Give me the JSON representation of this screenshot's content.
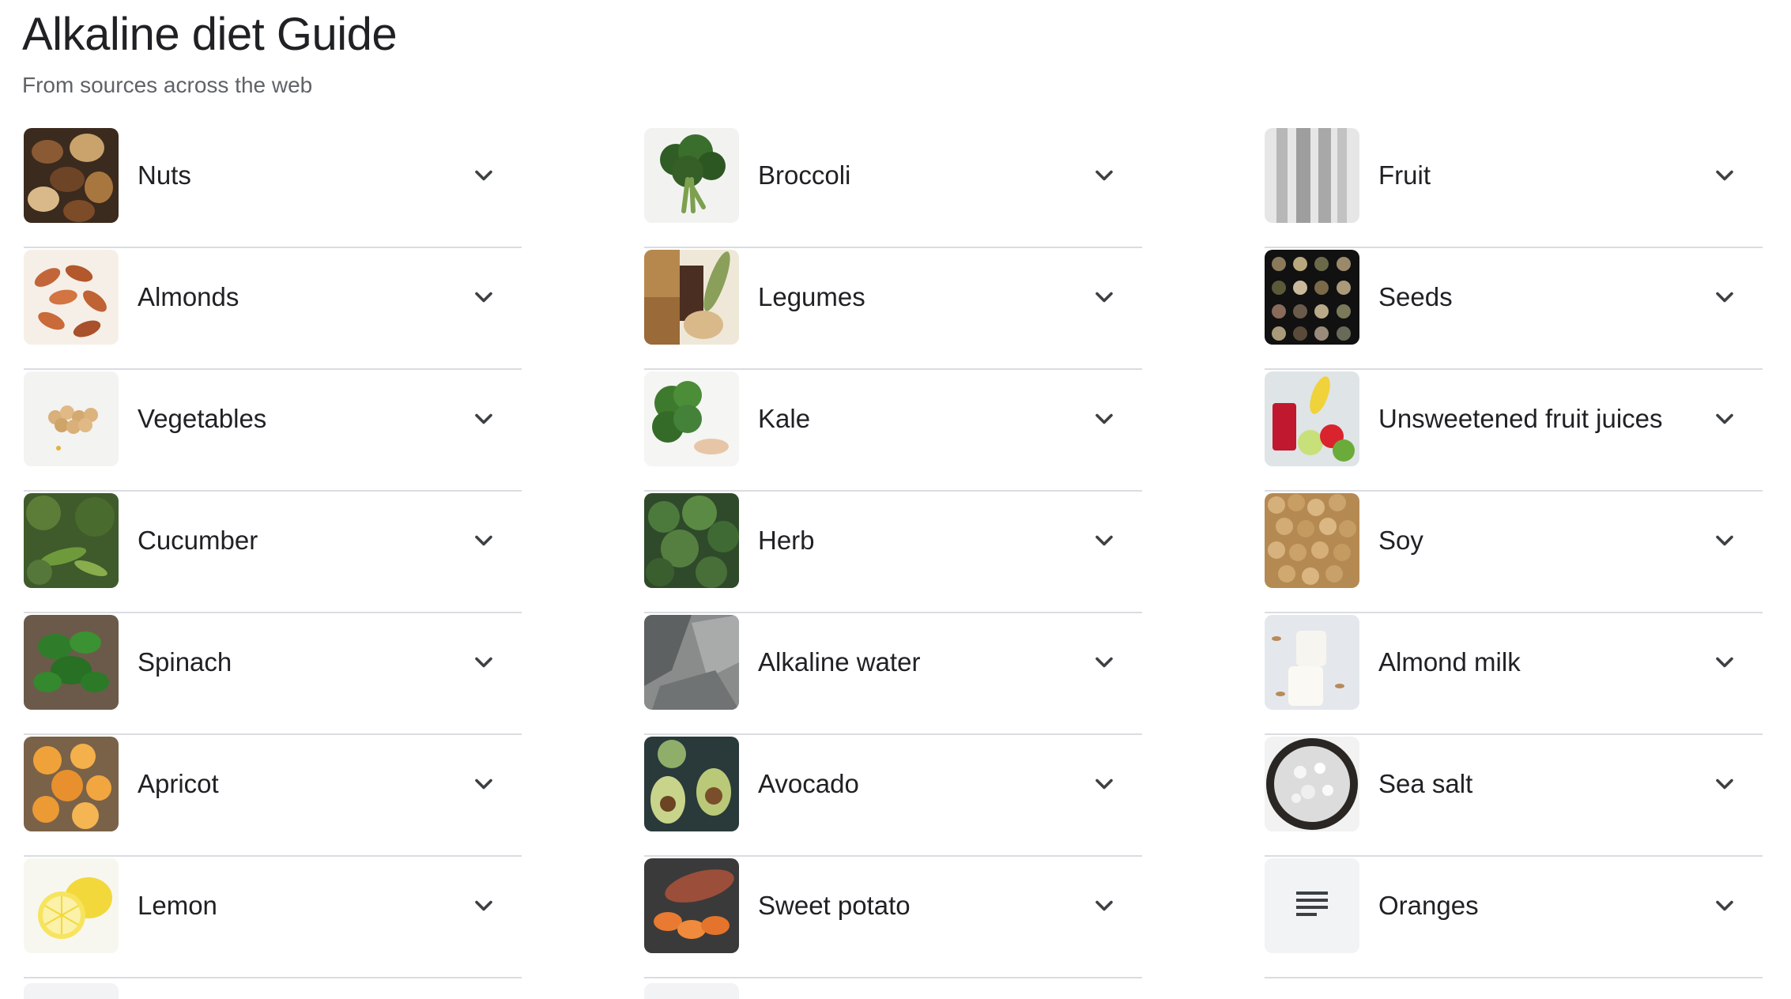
{
  "header": {
    "title": "Alkaline diet Guide",
    "subtitle": "From sources across the web"
  },
  "columns": [
    {
      "items": [
        {
          "label": "Nuts",
          "icon": "nuts-thumbnail"
        },
        {
          "label": "Almonds",
          "icon": "almonds-thumbnail"
        },
        {
          "label": "Vegetables",
          "icon": "vegetables-thumbnail"
        },
        {
          "label": "Cucumber",
          "icon": "cucumber-thumbnail"
        },
        {
          "label": "Spinach",
          "icon": "spinach-thumbnail"
        },
        {
          "label": "Apricot",
          "icon": "apricot-thumbnail"
        },
        {
          "label": "Lemon",
          "icon": "lemon-thumbnail"
        }
      ]
    },
    {
      "items": [
        {
          "label": "Broccoli",
          "icon": "broccoli-thumbnail"
        },
        {
          "label": "Legumes",
          "icon": "legumes-thumbnail"
        },
        {
          "label": "Kale",
          "icon": "kale-thumbnail"
        },
        {
          "label": "Herb",
          "icon": "herb-thumbnail"
        },
        {
          "label": "Alkaline water",
          "icon": "alkaline-water-thumbnail"
        },
        {
          "label": "Avocado",
          "icon": "avocado-thumbnail"
        },
        {
          "label": "Sweet potato",
          "icon": "sweet-potato-thumbnail"
        }
      ]
    },
    {
      "items": [
        {
          "label": "Fruit",
          "icon": "fruit-thumbnail"
        },
        {
          "label": "Seeds",
          "icon": "seeds-thumbnail"
        },
        {
          "label": "Unsweetened fruit juices",
          "icon": "fruit-juices-thumbnail"
        },
        {
          "label": "Soy",
          "icon": "soy-thumbnail"
        },
        {
          "label": "Almond milk",
          "icon": "almond-milk-thumbnail"
        },
        {
          "label": "Sea salt",
          "icon": "sea-salt-thumbnail"
        },
        {
          "label": "Oranges",
          "icon": "document-lines-icon"
        }
      ]
    }
  ],
  "colors": {
    "text": "#202124",
    "subtext": "#5f6368",
    "divider": "#dadce0",
    "chevron": "#3c4043"
  }
}
